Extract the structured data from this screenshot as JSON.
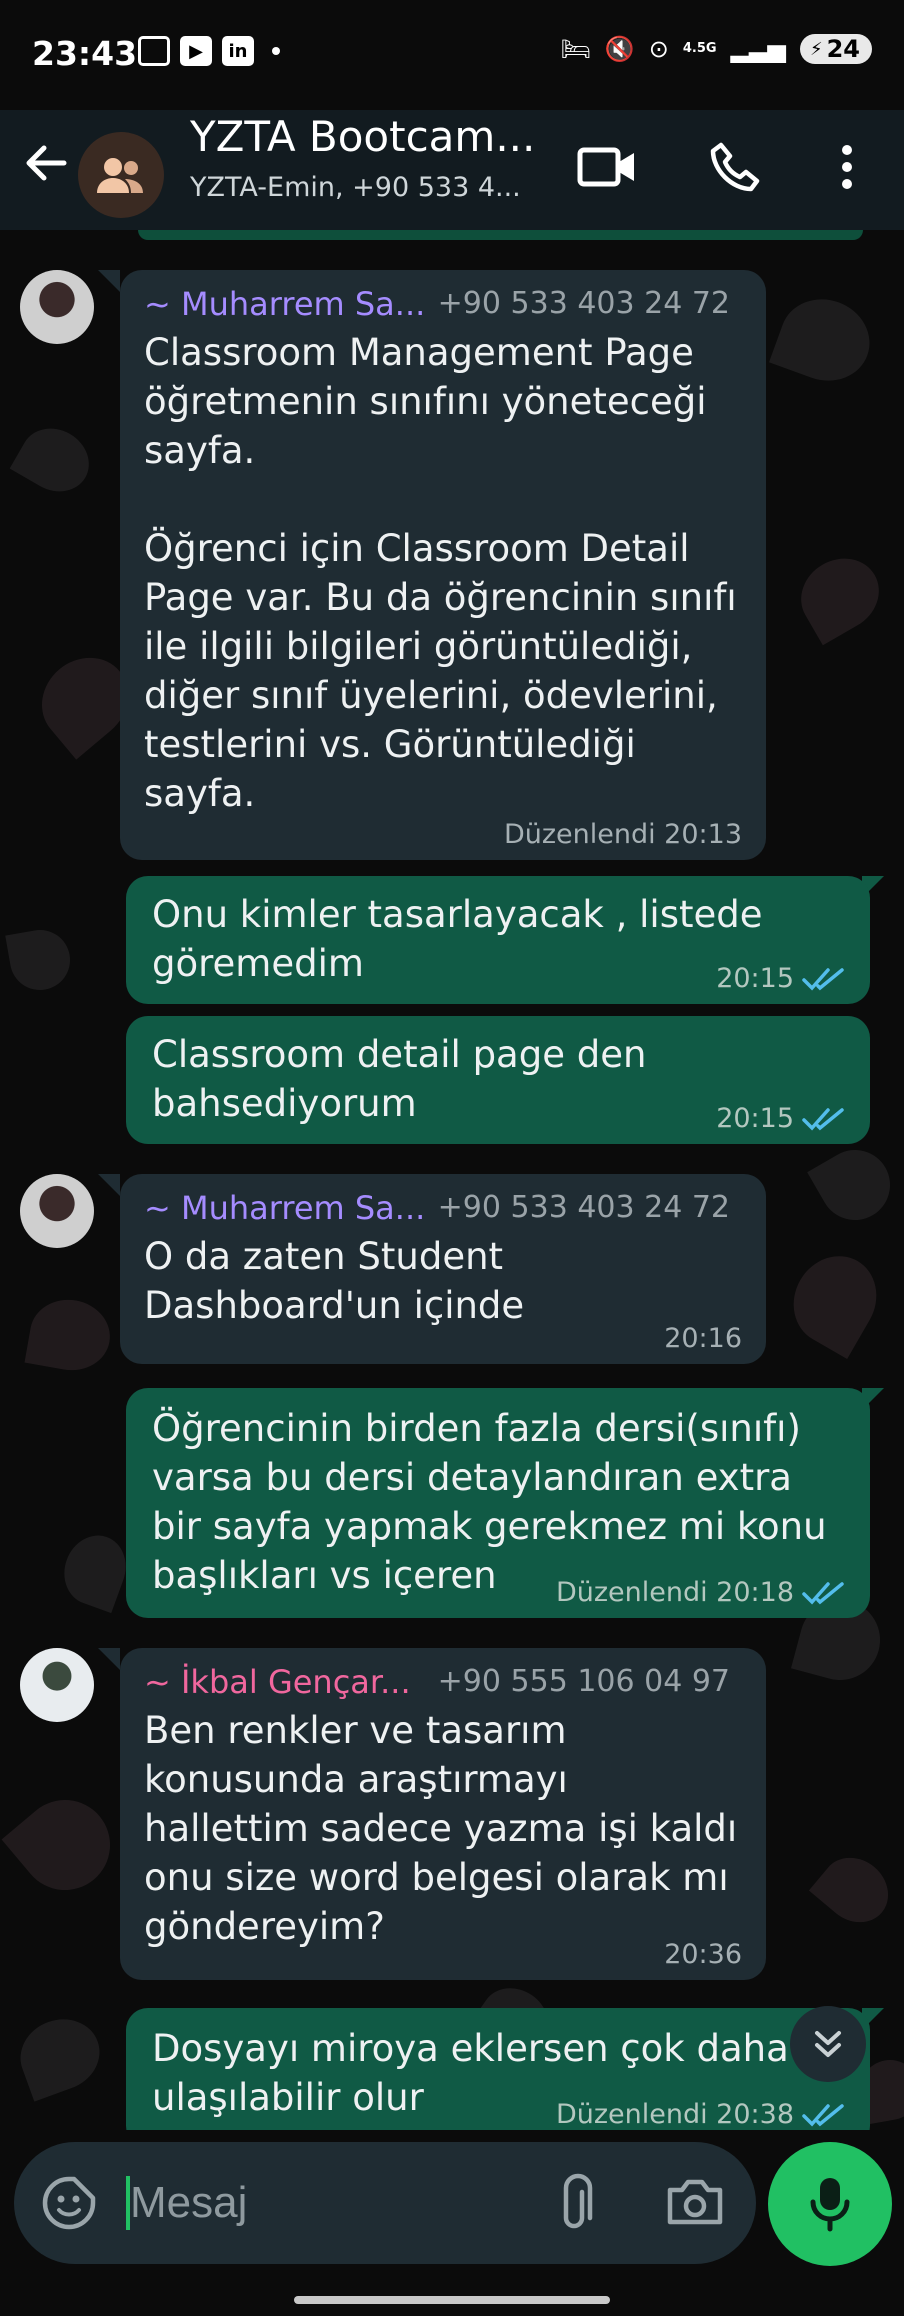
{
  "statusbar": {
    "time": "23:43",
    "network": "4.5G",
    "battery": "24"
  },
  "header": {
    "title": "YZTA Bootcam...",
    "subtitle": "YZTA-Emin, +90 533 4..."
  },
  "messages": [
    {
      "direction": "in",
      "sender": "~ Muharrem Sa...",
      "sender_color": "#a58cff",
      "phone": "+90 533 403 24 72",
      "text": "Classroom Management Page\nöğretmenin sınıfını yöneteceği\nsayfa.\n\nÖğrenci için Classroom Detail\nPage var. Bu da öğrencinin sınıfı\nile ilgili bilgileri görüntülediği,\ndiğer sınıf üyelerini, ödevlerini,\ntestlerini vs. Görüntülediği\nsayfa.",
      "meta": "Düzenlendi 20:13"
    },
    {
      "direction": "out",
      "text": "Onu kimler tasarlayacak , listede\ngöremedim",
      "meta": "20:15"
    },
    {
      "direction": "out",
      "text": "Classroom detail page den\nbahsediyorum",
      "meta": "20:15"
    },
    {
      "direction": "in",
      "sender": "~ Muharrem Sa...",
      "sender_color": "#a58cff",
      "phone": "+90 533 403 24 72",
      "text": "O da zaten Student\nDashboard'un içinde",
      "meta": "20:16"
    },
    {
      "direction": "out",
      "text": "Öğrencinin birden fazla dersi(sınıfı)\nvarsa bu dersi detaylandıran extra\nbir sayfa yapmak gerekmez mi konu\nbaşlıkları vs içeren",
      "meta": "Düzenlendi 20:18"
    },
    {
      "direction": "in",
      "sender": "~ İkbal Gençar...",
      "sender_color": "#f0679e",
      "phone": "+90 555 106 04 97",
      "text": "Ben renkler ve tasarım\nkonusunda araştırmayı\nhallettim sadece yazma işi kaldı\nonu size word belgesi olarak mı\ngöndereyim?",
      "meta": "20:36"
    },
    {
      "direction": "out",
      "text": "Dosyayı miroya eklersen çok daha\nulaşılabilir olur",
      "meta": "Düzenlendi 20:38"
    }
  ],
  "composer": {
    "placeholder": "Mesaj"
  },
  "colors": {
    "accent_green": "#21c063",
    "outgoing_bubble": "#105a45",
    "incoming_bubble": "#1f2c33",
    "read_ticks": "#53bdeb"
  }
}
